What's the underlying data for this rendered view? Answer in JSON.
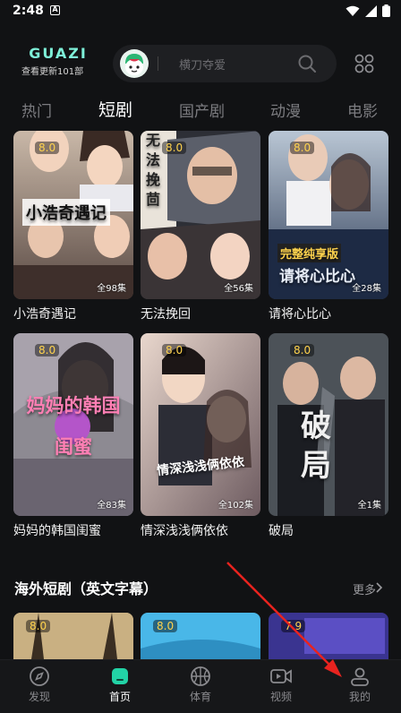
{
  "status": {
    "time": "2:48",
    "badge": "A"
  },
  "header": {
    "brand": "GUAZI",
    "update_text": "查看更新101部",
    "search_placeholder": "横刀夺爱"
  },
  "tabs": [
    "热门",
    "短剧",
    "国产剧",
    "动漫",
    "电影"
  ],
  "active_tab": "短剧",
  "cards": [
    {
      "name": "小浩奇遇记",
      "rating": "8.0",
      "episodes": "全98集",
      "poster_text": "小浩奇遇记"
    },
    {
      "name": "无法挽回",
      "rating": "8.0",
      "episodes": "全56集",
      "poster_text": "无法挽茴"
    },
    {
      "name": "请将心比心",
      "rating": "8.0",
      "episodes": "全28集",
      "poster_text": "请将心比心",
      "badge": "完整纯享版"
    },
    {
      "name": "妈妈的韩国闺蜜",
      "rating": "8.0",
      "episodes": "全83集",
      "poster_text": "妈妈的韩国闺蜜"
    },
    {
      "name": "情深浅浅俩依依",
      "rating": "8.0",
      "episodes": "全102集",
      "poster_text": "情深浅浅俩依依"
    },
    {
      "name": "破局",
      "rating": "8.0",
      "episodes": "全1集",
      "poster_text": "破局"
    }
  ],
  "section": {
    "title": "海外短剧（英文字幕）",
    "more": "更多"
  },
  "overseas": [
    {
      "rating": "8.0"
    },
    {
      "rating": "8.0"
    },
    {
      "rating": "7.9"
    }
  ],
  "nav": [
    {
      "label": "发现",
      "icon": "compass-icon"
    },
    {
      "label": "首页",
      "icon": "home-icon"
    },
    {
      "label": "体育",
      "icon": "basketball-icon"
    },
    {
      "label": "视频",
      "icon": "video-icon"
    },
    {
      "label": "我的",
      "icon": "profile-icon"
    }
  ],
  "colors": {
    "accent": "#22d3a6",
    "rating": "#ffd34d",
    "background": "#111214"
  }
}
